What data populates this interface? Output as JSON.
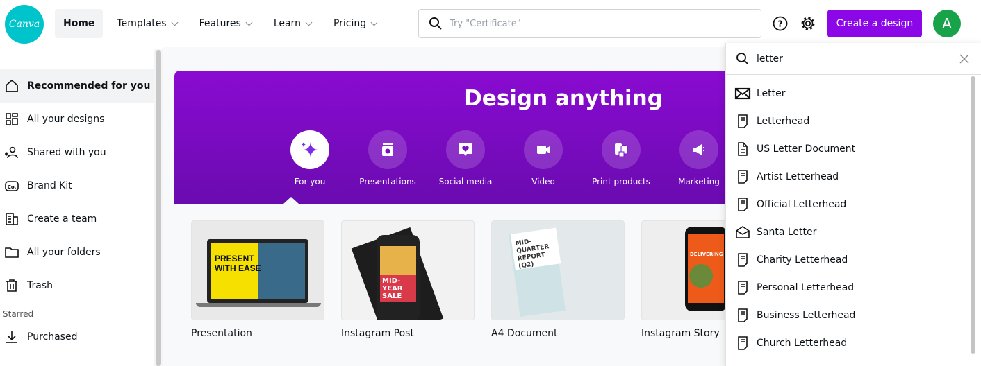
{
  "header": {
    "logo": "Canva",
    "nav": [
      {
        "label": "Home",
        "active": true
      },
      {
        "label": "Templates",
        "dropdown": true
      },
      {
        "label": "Features",
        "dropdown": true
      },
      {
        "label": "Learn",
        "dropdown": true
      },
      {
        "label": "Pricing",
        "dropdown": true
      }
    ],
    "search_placeholder": "Try \"Certificate\"",
    "create_label": "Create a design",
    "avatar_initial": "A",
    "accent": "#8b07e8"
  },
  "sidebar": {
    "items": [
      {
        "label": "Recommended for you",
        "icon": "home-icon",
        "active": true
      },
      {
        "label": "All your designs",
        "icon": "grid-icon"
      },
      {
        "label": "Shared with you",
        "icon": "shared-users-icon"
      },
      {
        "label": "Brand Kit",
        "icon": "brand-kit-icon"
      },
      {
        "label": "Create a team",
        "icon": "building-icon"
      },
      {
        "label": "All your folders",
        "icon": "folder-icon"
      },
      {
        "label": "Trash",
        "icon": "trash-icon"
      }
    ],
    "section": "Starred",
    "starred": [
      {
        "label": "Purchased",
        "icon": "download-icon"
      }
    ]
  },
  "banner": {
    "title": "Design anything",
    "categories": [
      {
        "label": "For you",
        "icon": "sparkle-icon",
        "active": true
      },
      {
        "label": "Presentations",
        "icon": "presentation-icon"
      },
      {
        "label": "Social media",
        "icon": "heart-bubble-icon"
      },
      {
        "label": "Video",
        "icon": "video-camera-icon"
      },
      {
        "label": "Print products",
        "icon": "print-icon"
      },
      {
        "label": "Marketing",
        "icon": "megaphone-icon"
      }
    ]
  },
  "cards": [
    {
      "label": "Presentation",
      "thumb_text": "PRESENT WITH EASE"
    },
    {
      "label": "Instagram Post",
      "thumb_text": "MID-YEAR SALE"
    },
    {
      "label": "A4 Document",
      "thumb_text": "MID-QUARTER REPORT (Q2)"
    },
    {
      "label": "Instagram Story",
      "thumb_text": "DELIVERING"
    }
  ],
  "dropdown": {
    "query": "letter",
    "results": [
      {
        "label": "Letter",
        "icon": "envelope-icon"
      },
      {
        "label": "Letterhead",
        "icon": "letterhead-icon"
      },
      {
        "label": "US Letter Document",
        "icon": "document-icon"
      },
      {
        "label": "Artist Letterhead",
        "icon": "letterhead-icon"
      },
      {
        "label": "Official Letterhead",
        "icon": "letterhead-icon"
      },
      {
        "label": "Santa Letter",
        "icon": "open-envelope-icon"
      },
      {
        "label": "Charity Letterhead",
        "icon": "letterhead-icon"
      },
      {
        "label": "Personal Letterhead",
        "icon": "letterhead-icon"
      },
      {
        "label": "Business Letterhead",
        "icon": "letterhead-icon"
      },
      {
        "label": "Church Letterhead",
        "icon": "letterhead-icon"
      }
    ]
  }
}
